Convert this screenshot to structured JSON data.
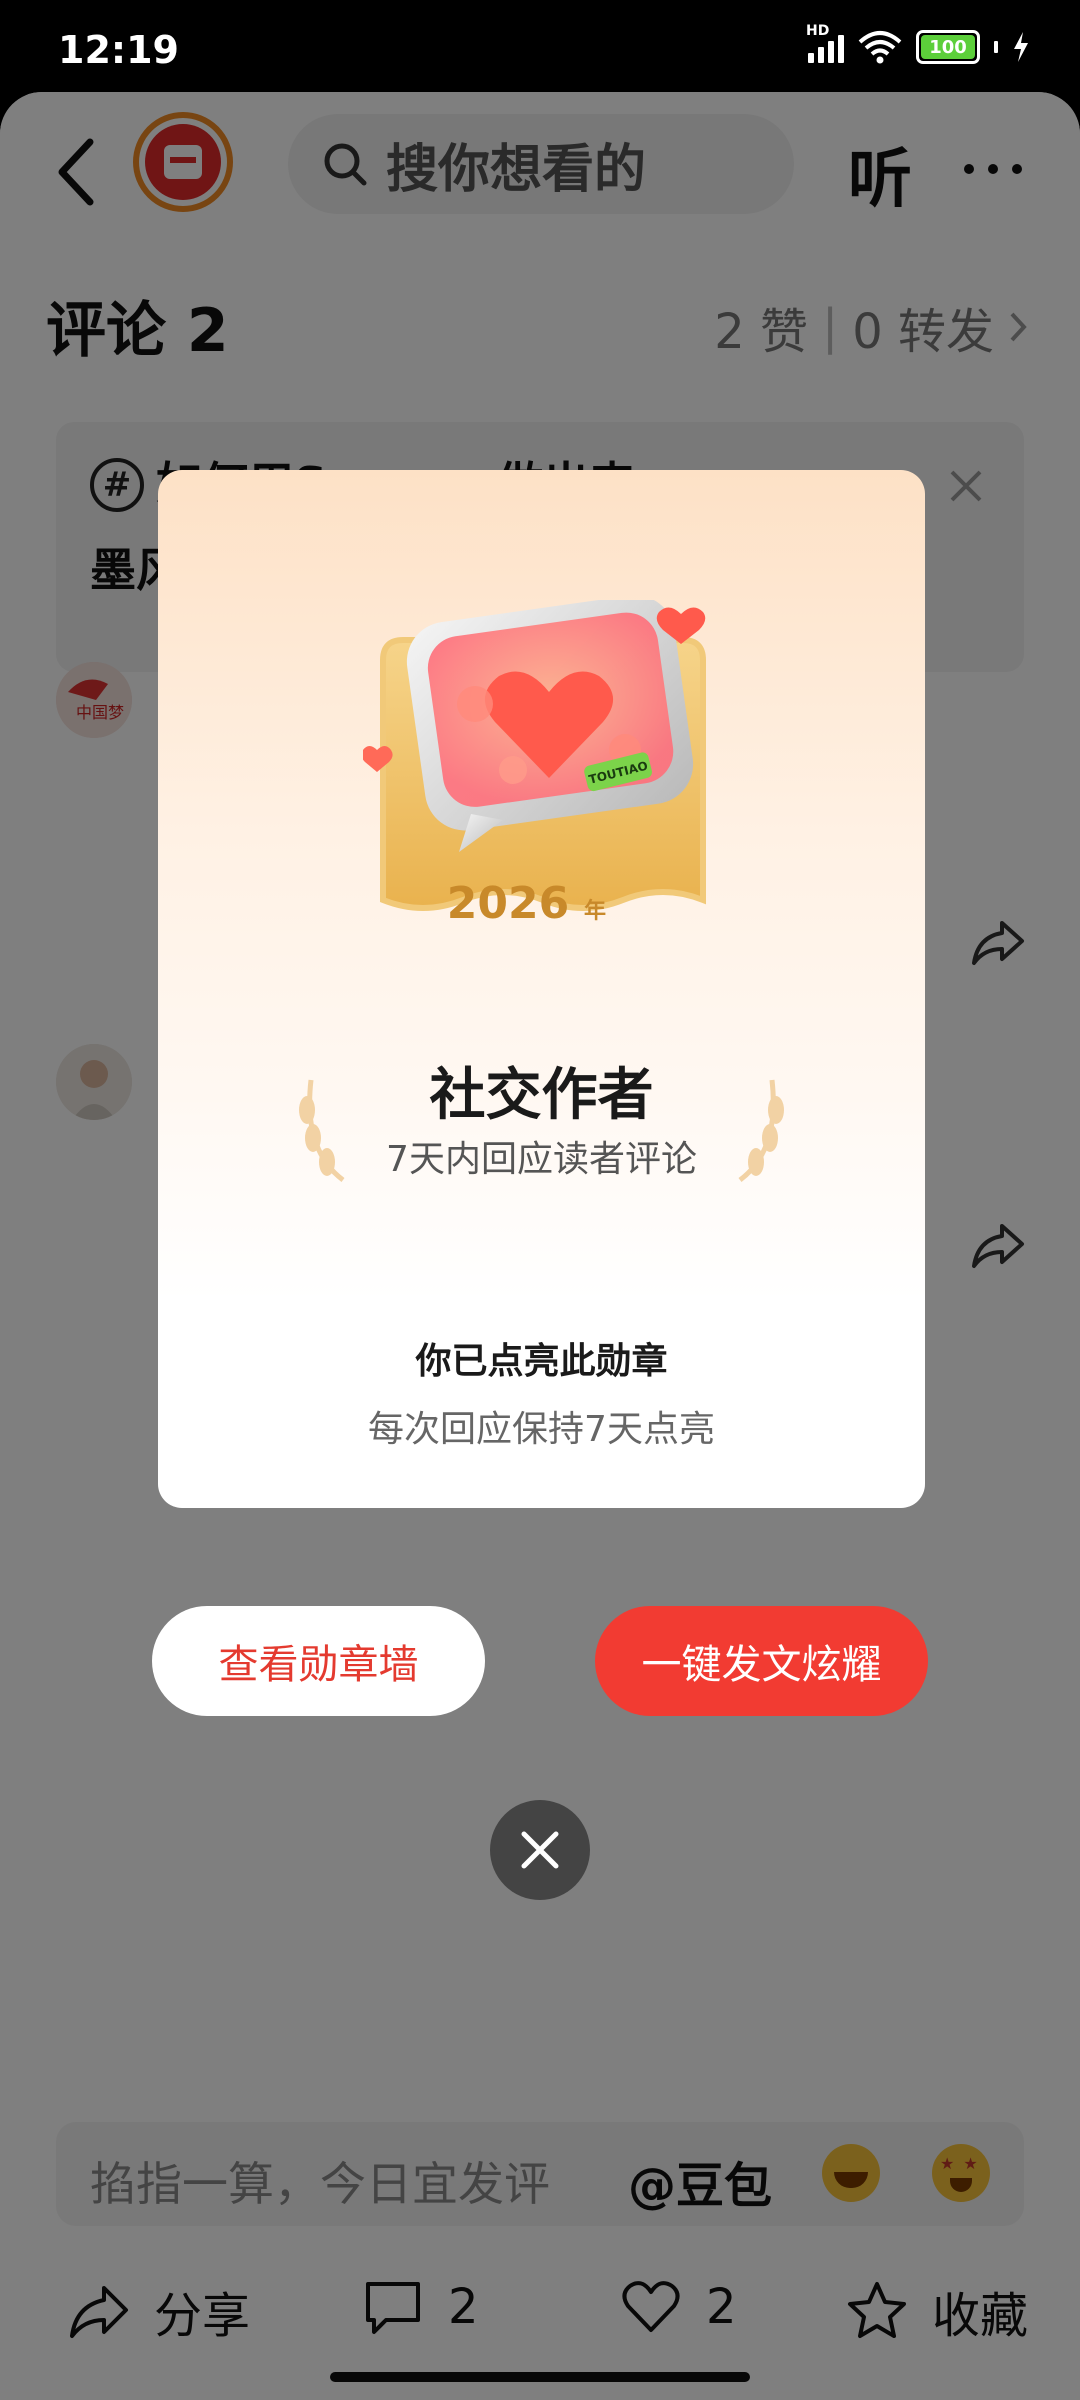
{
  "status_bar": {
    "time": "12:19",
    "network_label": "HD",
    "battery": "100"
  },
  "header": {
    "search_placeholder": "搜你想看的",
    "listen_label": "听"
  },
  "comments": {
    "title": "评论 2",
    "likes": "2 赞",
    "shares": "0 转发"
  },
  "topic": {
    "line1": "如何用S",
    "line1_suffix": "做出来",
    "line2": "墨风"
  },
  "input": {
    "placeholder": "掐指一算，今日宜发评",
    "mention": "@豆包"
  },
  "bottom_bar": {
    "share_label": "分享",
    "comment_count": "2",
    "like_count": "2",
    "favorite_label": "收藏"
  },
  "modal": {
    "badge_year": "2026",
    "badge_year_unit": "年",
    "badge_brand": "TOUTIAO",
    "badge_title": "社交作者",
    "badge_desc": "7天内回应读者评论",
    "lit_title": "你已点亮此勋章",
    "lit_desc": "每次回应保持7天点亮",
    "btn_wall": "查看勋章墙",
    "btn_post": "一键发文炫耀"
  },
  "colors": {
    "primary_red": "#f23b32",
    "overlay": "rgba(0,0,0,0.5)",
    "badge_gold": "#f2c46a"
  }
}
